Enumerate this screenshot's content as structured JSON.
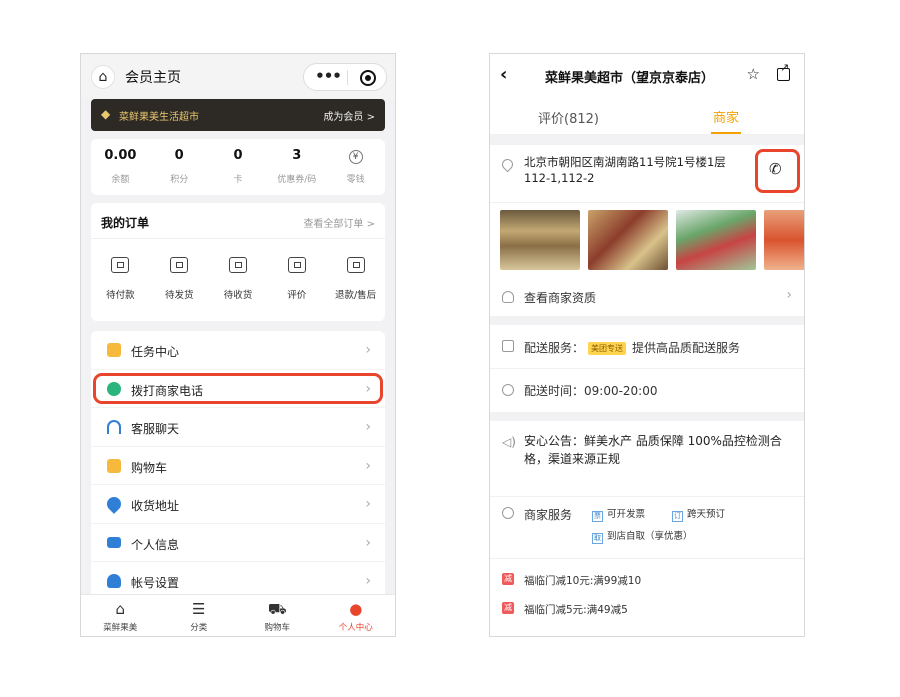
{
  "left_screen": {
    "nav": {
      "title": "会员主页",
      "more_icon": "•••",
      "home_icon": "home-icon",
      "target_icon": "target-icon"
    },
    "member_bar": {
      "store_name": "菜鲜果美生活超市",
      "join_label": "成为会员 >"
    },
    "stats": [
      {
        "value": "0.00",
        "label": "余额"
      },
      {
        "value": "0",
        "label": "积分"
      },
      {
        "value": "0",
        "label": "卡"
      },
      {
        "value": "3",
        "label": "优惠券/码"
      },
      {
        "value": "¥",
        "label": "零钱"
      }
    ],
    "orders": {
      "title": "我的订单",
      "view_all": "查看全部订单 >",
      "items": [
        {
          "label": "待付款"
        },
        {
          "label": "待发货"
        },
        {
          "label": "待收货"
        },
        {
          "label": "评价"
        },
        {
          "label": "退款/售后"
        }
      ]
    },
    "menu": [
      {
        "label": "任务中心",
        "icon": "task-icon",
        "color": "#f6b93b"
      },
      {
        "label": "拨打商家电话",
        "icon": "phone-icon",
        "color": "#2bb57c",
        "highlighted": true
      },
      {
        "label": "客服聊天",
        "icon": "headset-icon",
        "color": "#2f7fd6"
      },
      {
        "label": "购物车",
        "icon": "cart-icon",
        "color": "#f6b93b"
      },
      {
        "label": "收货地址",
        "icon": "location-icon",
        "color": "#2f7fd6"
      },
      {
        "label": "个人信息",
        "icon": "id-card-icon",
        "color": "#2f7fd6"
      },
      {
        "label": "帐号设置",
        "icon": "user-settings-icon",
        "color": "#2f7fd6"
      }
    ],
    "tabbar": [
      {
        "label": "菜鲜果美",
        "icon": "home-icon"
      },
      {
        "label": "分类",
        "icon": "category-icon"
      },
      {
        "label": "购物车",
        "icon": "cart-icon"
      },
      {
        "label": "个人中心",
        "icon": "user-icon",
        "active": true
      }
    ],
    "accent": "#e8452c"
  },
  "right_screen": {
    "nav": {
      "title": "菜鲜果美超市（望京京泰店）"
    },
    "tabs": [
      {
        "label": "评价(812)"
      },
      {
        "label": "商家",
        "active": true
      }
    ],
    "address": "北京市朝阳区南湖南路11号院1号楼1层112-1,112-2",
    "qualification": "查看商家资质",
    "delivery": {
      "label": "配送服务：",
      "badge": "美团专送",
      "desc": "提供高品质配送服务"
    },
    "delivery_time": "配送时间：09:00-20:00",
    "notice": "安心公告：鲜美水产 品质保障 100%品控检测合格，渠道来源正规",
    "services": {
      "label": "商家服务",
      "items": [
        {
          "icon_text": "票",
          "label": "可开发票"
        },
        {
          "icon_text": "订",
          "label": "跨天预订"
        },
        {
          "icon_text": "取",
          "label": "到店自取（享优惠）"
        }
      ]
    },
    "promotions": [
      {
        "tag": "减",
        "text": "福临门减10元:满99减10"
      },
      {
        "tag": "减",
        "text": "福临门减5元:满49减5"
      }
    ],
    "accent": "#f4a200"
  }
}
